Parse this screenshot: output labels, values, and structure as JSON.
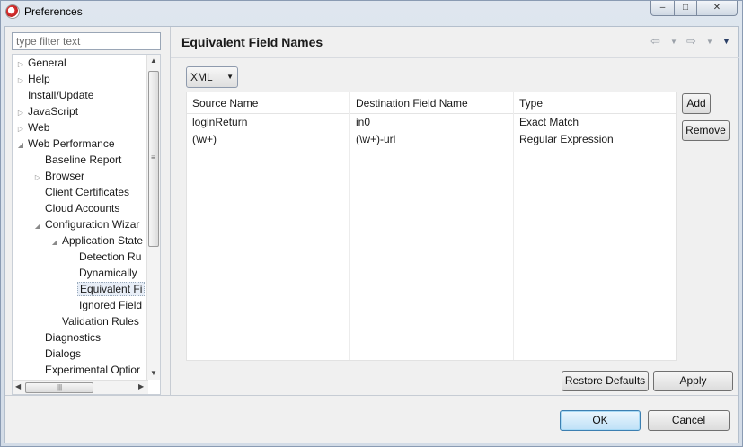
{
  "window": {
    "title": "Preferences",
    "controls": {
      "minimize": "‒",
      "maximize": "□",
      "close": "✕"
    }
  },
  "sidebar": {
    "filter_placeholder": "type filter text",
    "tree": [
      {
        "label": "General",
        "twisty": "▷"
      },
      {
        "label": "Help",
        "twisty": "▷"
      },
      {
        "label": "Install/Update",
        "twisty": ""
      },
      {
        "label": "JavaScript",
        "twisty": "▷"
      },
      {
        "label": "Web",
        "twisty": "▷"
      },
      {
        "label": "Web Performance",
        "twisty": "◢"
      },
      {
        "label": "Baseline Report",
        "twisty": ""
      },
      {
        "label": "Browser",
        "twisty": "▷"
      },
      {
        "label": "Client Certificates",
        "twisty": ""
      },
      {
        "label": "Cloud Accounts",
        "twisty": ""
      },
      {
        "label": "Configuration Wizar",
        "twisty": "◢"
      },
      {
        "label": "Application State",
        "twisty": "◢"
      },
      {
        "label": "Detection Ru",
        "twisty": ""
      },
      {
        "label": "Dynamically",
        "twisty": ""
      },
      {
        "label": "Equivalent Fi",
        "twisty": "",
        "selected": true
      },
      {
        "label": "Ignored Field",
        "twisty": ""
      },
      {
        "label": "Validation Rules",
        "twisty": ""
      },
      {
        "label": "Diagnostics",
        "twisty": ""
      },
      {
        "label": "Dialogs",
        "twisty": ""
      },
      {
        "label": "Experimental Optior",
        "twisty": ""
      }
    ]
  },
  "page": {
    "title": "Equivalent Field Names",
    "format_select": {
      "value": "XML"
    },
    "table": {
      "columns": [
        "Source Name",
        "Destination Field Name",
        "Type"
      ],
      "rows": [
        [
          "loginReturn",
          "in0",
          "Exact Match"
        ],
        [
          "(\\w+)",
          "(\\w+)-url",
          "Regular Expression"
        ]
      ]
    },
    "buttons": {
      "add": "Add",
      "remove": "Remove",
      "restore_defaults": "Restore Defaults",
      "apply": "Apply"
    }
  },
  "dialog": {
    "ok": "OK",
    "cancel": "Cancel"
  }
}
